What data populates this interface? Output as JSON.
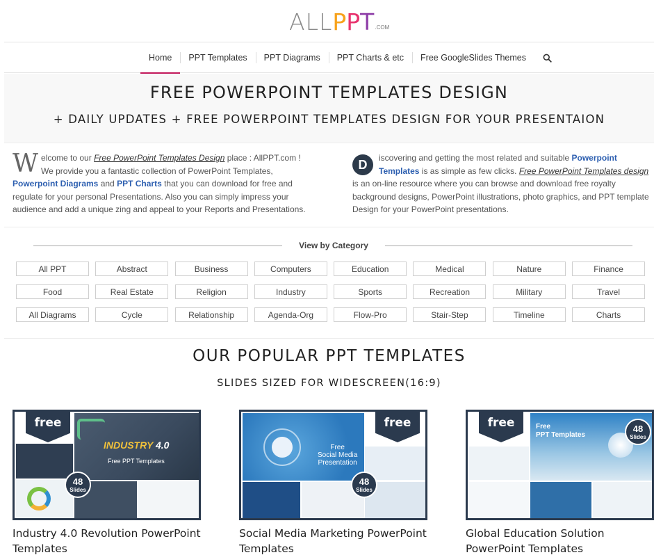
{
  "brand": {
    "logo_all": "ALL",
    "logo_p1": "P",
    "logo_p2": "P",
    "logo_t": "T",
    "logo_com": ".COM",
    "colors": {
      "p1": "#f7a21b",
      "p2": "#e8336e",
      "t": "#8e3ea8",
      "accent": "#c2185b",
      "navy": "#2b3a4e",
      "link": "#2d5fb0"
    }
  },
  "nav": {
    "items": [
      {
        "label": "Home",
        "active": true
      },
      {
        "label": "PPT Templates"
      },
      {
        "label": "PPT Diagrams"
      },
      {
        "label": "PPT Charts & etc"
      },
      {
        "label": "Free GoogleSlides Themes"
      }
    ],
    "search_icon": "search-icon"
  },
  "hero": {
    "title": "FREE POWERPOINT TEMPLATES DESIGN",
    "subtitle": "+ DAILY UPDATES + FREE POWERPOINT TEMPLATES DESIGN FOR YOUR PRESENTAION"
  },
  "intro_left": {
    "dropcap": "W",
    "t1": "elcome to our ",
    "link1": "Free PowerPoint Templates Design",
    "t2": " place : AllPPT.com ! We provide you a fantastic collection of PowerPoint Templates, ",
    "link2": "Powerpoint Diagrams",
    "t3": " and ",
    "link3": "PPT Charts",
    "t4": " that you can download for free and regulate for your personal Presentations. Also you can simply impress your audience and add a unique zing and appeal to your Reports and Presentations."
  },
  "intro_right": {
    "dropcap": "D",
    "t1": "iscovering and getting the most related and suitable ",
    "link1": "Powerpoint Templates",
    "t2": " is as simple as few clicks. ",
    "link2": "Free PowerPoint Templates design",
    "t3": " is an on-line resource where you can browse and download free royalty background designs, PowerPoint illustrations, photo graphics, and PPT template Design for your PowerPoint presentations."
  },
  "category": {
    "title": "View by Category",
    "items": [
      "All PPT",
      "Abstract",
      "Business",
      "Computers",
      "Education",
      "Medical",
      "Nature",
      "Finance",
      "Food",
      "Real Estate",
      "Religion",
      "Industry",
      "Sports",
      "Recreation",
      "Military",
      "Travel",
      "All Diagrams",
      "Cycle",
      "Relationship",
      "Agenda-Org",
      "Flow-Pro",
      "Stair-Step",
      "Timeline",
      "Charts"
    ]
  },
  "popular": {
    "title": "OUR POPULAR PPT TEMPLATES",
    "subtitle": "SLIDES SIZED FOR WIDESCREEN(16:9)",
    "cards": [
      {
        "title": "Industry 4.0 Revolution PowerPoint Templates",
        "ribbon": "free",
        "badge_num": "48",
        "badge_label": "Slides",
        "thumb_word1": "INDUSTRY",
        "thumb_word2": "4.0",
        "thumb_sub": "Free PPT Templates"
      },
      {
        "title": "Social Media Marketing PowerPoint Templates",
        "ribbon": "free",
        "badge_num": "48",
        "badge_label": "Slides",
        "thumb_l1": "Free",
        "thumb_l2": "Social Media",
        "thumb_l3": "Presentation"
      },
      {
        "title": "Global Education Solution PowerPoint Templates",
        "ribbon": "free",
        "badge_num": "48",
        "badge_label": "Slides",
        "thumb_l1": "Free",
        "thumb_l2": "PPT Templates"
      }
    ]
  }
}
